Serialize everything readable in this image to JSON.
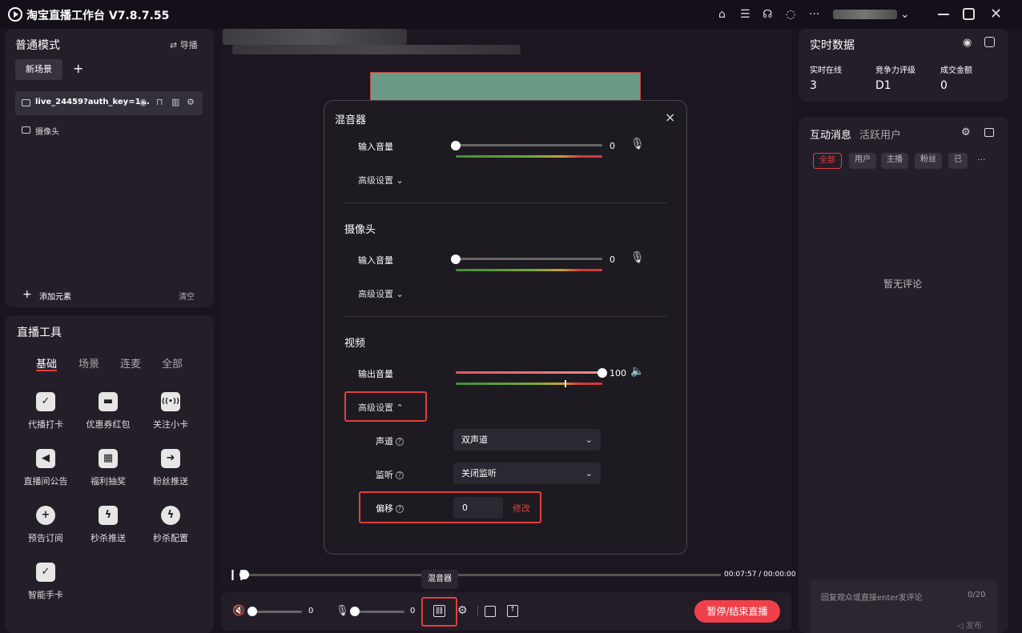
{
  "titlebar": {
    "app_title": "淘宝直播工作台 V7.8.7.55",
    "icons": [
      "home-icon",
      "list-icon",
      "headset-icon",
      "chat-icon",
      "more-icon"
    ],
    "more": "···"
  },
  "left": {
    "mode_title": "普通模式",
    "guide_label": "⇄ 导播",
    "scene_tab": "新场景",
    "add": "+",
    "source_label": "live_24459?auth_key=1...",
    "camera_label": "摄像头",
    "add_element": "添加元素",
    "clear": "清空"
  },
  "tools": {
    "title": "直播工具",
    "tabs": [
      "基础",
      "场景",
      "连麦",
      "全部"
    ],
    "items": [
      {
        "label": "代播打卡",
        "icon": "calendar-check-icon",
        "glyph": "✓"
      },
      {
        "label": "优惠券红包",
        "icon": "red-envelope-icon",
        "glyph": "▬"
      },
      {
        "label": "关注小卡",
        "icon": "broadcast-icon",
        "glyph": "((•))"
      },
      {
        "label": "直播间公告",
        "icon": "speaker-icon",
        "glyph": "◀"
      },
      {
        "label": "福利抽奖",
        "icon": "gift-icon",
        "glyph": "▦"
      },
      {
        "label": "粉丝推送",
        "icon": "push-icon",
        "glyph": "➜"
      },
      {
        "label": "预告订阅",
        "icon": "subscribe-icon",
        "glyph": "+"
      },
      {
        "label": "秒杀推送",
        "icon": "flash-push-icon",
        "glyph": "ϟ"
      },
      {
        "label": "秒杀配置",
        "icon": "flash-config-icon",
        "glyph": "ϟ"
      },
      {
        "label": "智能手卡",
        "icon": "smart-card-icon",
        "glyph": "✓"
      }
    ]
  },
  "mixer": {
    "title": "混音器",
    "close": "×",
    "top": {
      "input_label": "输入音量",
      "value": "0",
      "advanced": "高级设置 ⌄"
    },
    "camera": {
      "title": "摄像头",
      "input_label": "输入音量",
      "value": "0",
      "advanced": "高级设置 ⌄"
    },
    "video": {
      "title": "视频",
      "output_label": "输出音量",
      "value": "100",
      "level": 1.0,
      "advanced": "高级设置 ⌃",
      "channel_label": "声道",
      "channel_value": "双声道",
      "monitor_label": "监听",
      "monitor_value": "关闭监听",
      "offset_label": "偏移",
      "offset_value": "0",
      "modify": "修改"
    }
  },
  "player": {
    "time": "00:07:57 / 00:00:00",
    "tooltip": "混音器",
    "vol1": "0",
    "vol2": "0",
    "end_button": "暂停/结束直播"
  },
  "stats": {
    "title": "实时数据",
    "items": [
      {
        "label": "实时在线",
        "value": "3"
      },
      {
        "label": "竞争力评级",
        "value": "D1"
      },
      {
        "label": "成交金额",
        "value": "0"
      }
    ]
  },
  "messages": {
    "title": "互动消息",
    "subtitle": "活跃用户",
    "filters": [
      "全部",
      "用户",
      "主播",
      "粉丝",
      "已"
    ],
    "more": "···",
    "empty": "暂无评论",
    "input_placeholder": "回复观众或直接enter发评论",
    "count": "0/20",
    "send": "◁ 发布"
  },
  "colors": {
    "accent": "#e0413b",
    "brand_button": "#f0414a"
  }
}
